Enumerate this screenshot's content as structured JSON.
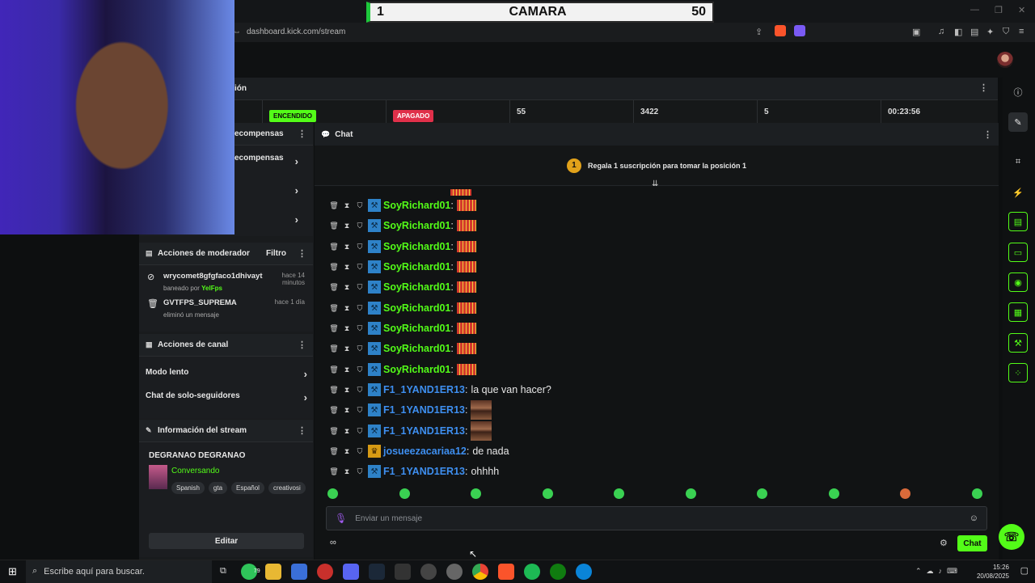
{
  "overlay": {
    "score_left": "1",
    "title": "CAMARA",
    "score_right": "50"
  },
  "browser": {
    "url": "dashboard.kick.com/stream"
  },
  "stats": {
    "header_fragment": "ión",
    "status_on": "ENCENDIDO",
    "status_off": "APAGADO",
    "values": [
      "55",
      "3422",
      "5",
      "00:23:56"
    ]
  },
  "rewards": {
    "header": "ecompensas",
    "item": "ecompensas"
  },
  "mod_actions": {
    "title": "Acciones de moderador",
    "filter": "Filtro",
    "items": [
      {
        "user": "wrycomet8gfgfaco1dhivayt",
        "time": "hace 14 minutos",
        "detail_prefix": "baneado por ",
        "detail_user": "YelFps"
      },
      {
        "user": "GVTFPS_SUPREMA",
        "time": "hace 1 día",
        "detail": "eliminó un mensaje"
      }
    ]
  },
  "channel_actions": {
    "title": "Acciones de canal",
    "items": [
      "Modo lento",
      "Chat de solo-seguidores"
    ]
  },
  "stream_info": {
    "title": "Información del stream",
    "stream_title": "DEGRANAO DEGRANAO",
    "category": "Conversando",
    "tags": [
      "Spanish",
      "gta",
      "Español",
      "creativosi"
    ],
    "edit_label": "Editar"
  },
  "chat": {
    "title": "Chat",
    "pinned": "Regala 1 suscripción para tomar la posición 1",
    "pinned_rank": "1",
    "messages": [
      {
        "user": "SoyRichard01",
        "role": "mod",
        "color": "#53fc18",
        "text": "",
        "emote": "stack"
      },
      {
        "user": "SoyRichard01",
        "role": "mod",
        "color": "#53fc18",
        "text": "",
        "emote": "stack"
      },
      {
        "user": "SoyRichard01",
        "role": "mod",
        "color": "#53fc18",
        "text": "",
        "emote": "stack"
      },
      {
        "user": "SoyRichard01",
        "role": "mod",
        "color": "#53fc18",
        "text": "",
        "emote": "stack"
      },
      {
        "user": "SoyRichard01",
        "role": "mod",
        "color": "#53fc18",
        "text": "",
        "emote": "stack"
      },
      {
        "user": "SoyRichard01",
        "role": "mod",
        "color": "#53fc18",
        "text": "",
        "emote": "stack"
      },
      {
        "user": "SoyRichard01",
        "role": "mod",
        "color": "#53fc18",
        "text": "",
        "emote": "stack"
      },
      {
        "user": "SoyRichard01",
        "role": "mod",
        "color": "#53fc18",
        "text": "",
        "emote": "stack"
      },
      {
        "user": "SoyRichard01",
        "role": "mod",
        "color": "#53fc18",
        "text": "",
        "emote": "stack"
      },
      {
        "user": "F1_1YAND1ER13",
        "role": "mod",
        "color": "#3e8ff0",
        "text": "la que van hacer?",
        "emote": ""
      },
      {
        "user": "F1_1YAND1ER13",
        "role": "mod",
        "color": "#3e8ff0",
        "text": "",
        "emote": "pic"
      },
      {
        "user": "F1_1YAND1ER13",
        "role": "mod",
        "color": "#3e8ff0",
        "text": "",
        "emote": "pic"
      },
      {
        "user": "josueezacariaa12",
        "role": "vip",
        "color": "#3e8ff0",
        "text": "de nada",
        "emote": ""
      },
      {
        "user": "F1_1YAND1ER13",
        "role": "mod",
        "color": "#3e8ff0",
        "text": "ohhhh",
        "emote": ""
      }
    ],
    "input_placeholder": "Enviar un mensaje",
    "send_label": "Chat",
    "infinity": "∞"
  },
  "taskbar": {
    "search_placeholder": "Escribe aquí para buscar.",
    "time": "15:26",
    "date": "20/08/2025",
    "badge_count": "79"
  },
  "colors": {
    "accent": "#53fc18",
    "off": "#e0304a"
  }
}
